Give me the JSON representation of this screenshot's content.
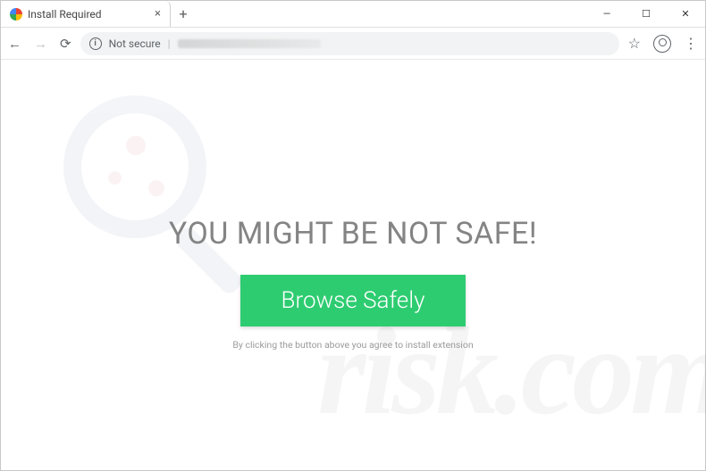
{
  "tab": {
    "title": "Install Required"
  },
  "address_bar": {
    "security_text": "Not secure"
  },
  "page": {
    "headline": "YOU MIGHT BE NOT SAFE!",
    "cta_label": "Browse Safely",
    "disclaimer": "By clicking the button above you agree to install extension"
  },
  "watermark_text": "risk.com"
}
